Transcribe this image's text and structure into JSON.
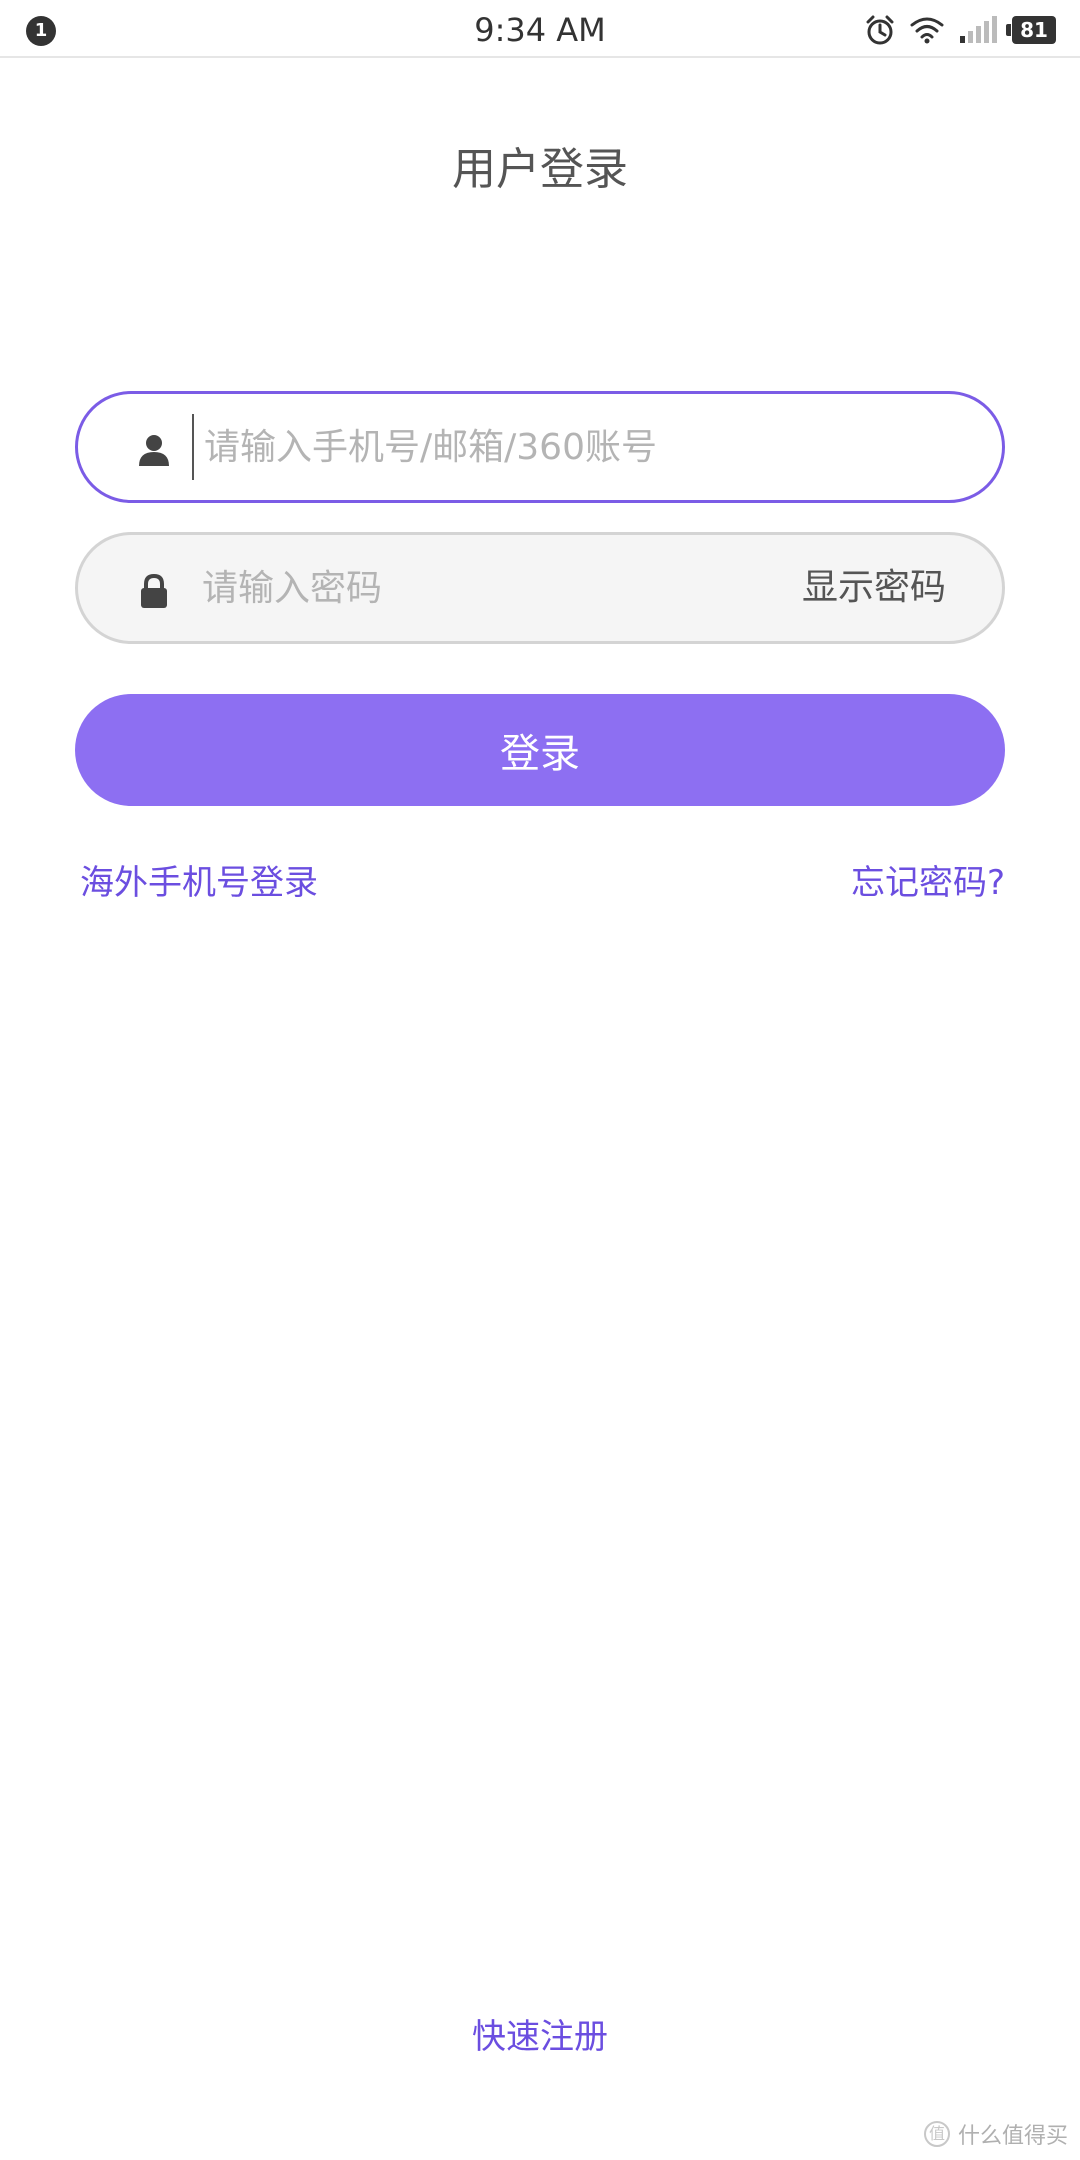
{
  "status_bar": {
    "notification_count": "1",
    "time": "9:34 AM",
    "battery_level": "81",
    "icons": [
      "alarm-icon",
      "wifi-icon",
      "signal-icon",
      "battery-icon"
    ]
  },
  "page": {
    "title": "用户登录"
  },
  "account_field": {
    "value": "",
    "placeholder": "请输入手机号/邮箱/360账号",
    "icon": "user-icon"
  },
  "password_field": {
    "value": "",
    "placeholder": "请输入密码",
    "icon": "lock-icon",
    "show_password_label": "显示密码"
  },
  "login_button": {
    "label": "登录"
  },
  "links": {
    "overseas_phone_login": "海外手机号登录",
    "forgot_password": "忘记密码?",
    "quick_register": "快速注册"
  },
  "watermark": {
    "text": "什么值得买",
    "logo_glyph": "值"
  },
  "colors": {
    "accent": "#8d6ff2",
    "link": "#6b4ee0",
    "focused_border": "#7b5ce6",
    "field_background": "#f5f5f5"
  }
}
